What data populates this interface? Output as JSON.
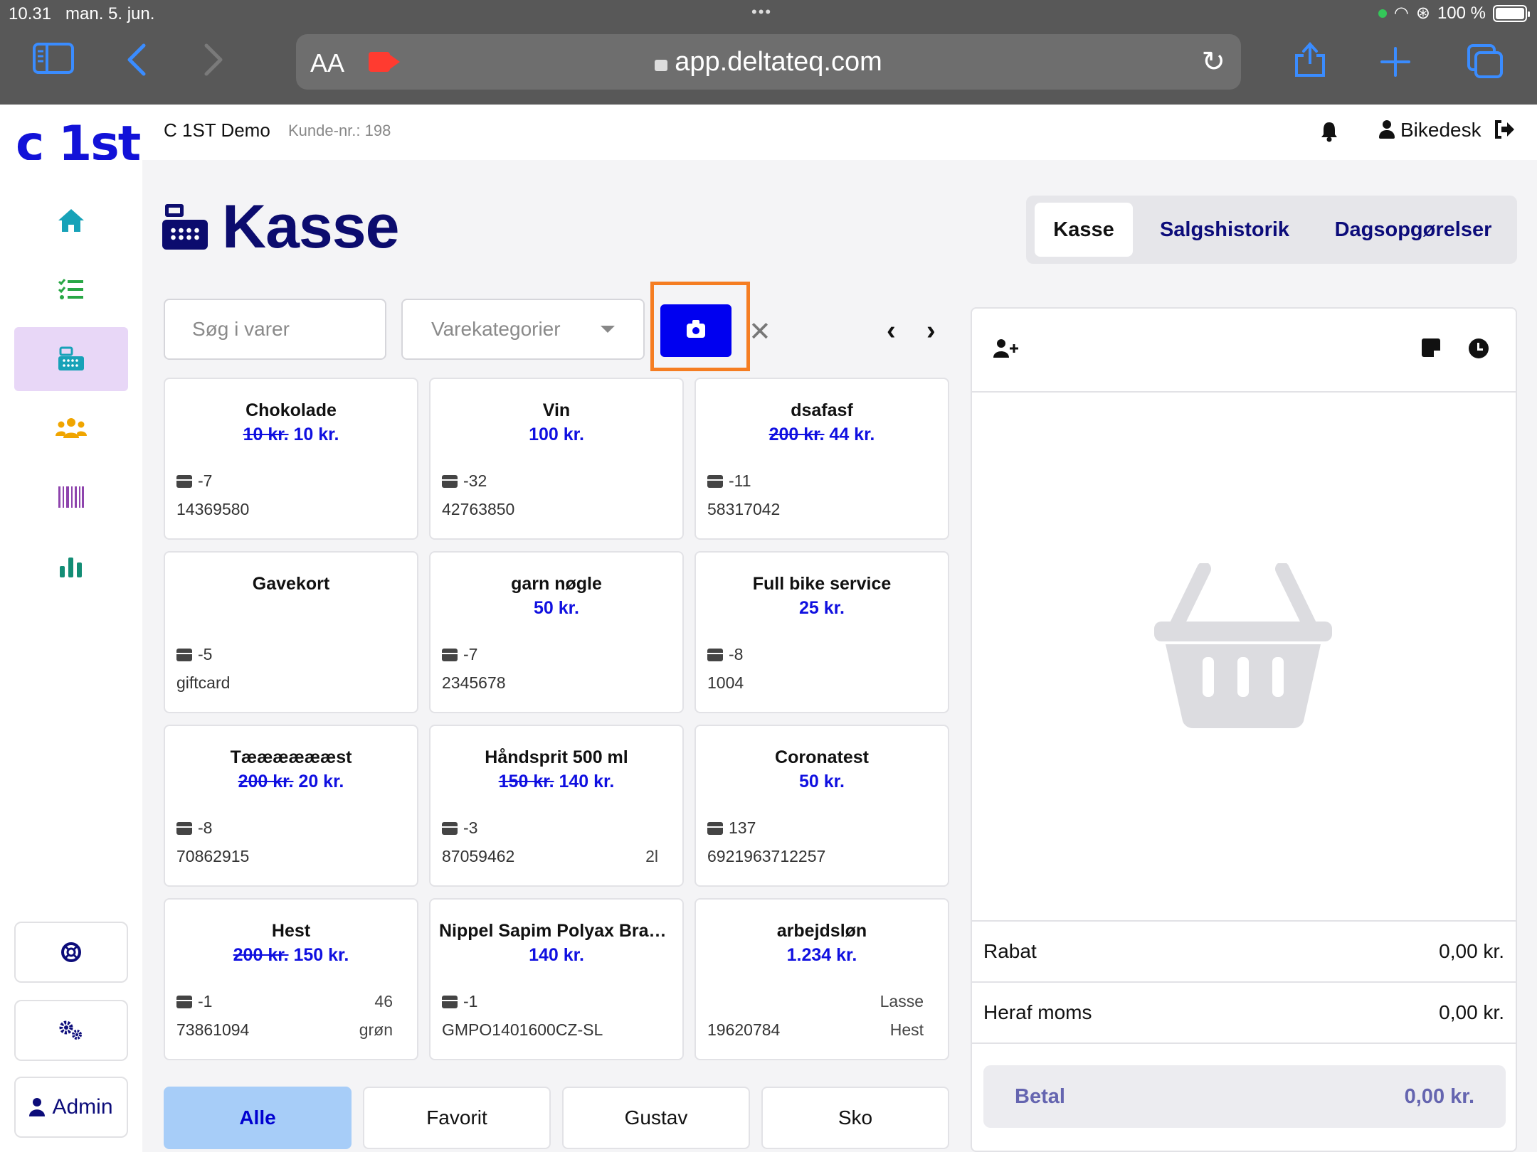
{
  "status_bar": {
    "time": "10.31",
    "date": "man. 5. jun.",
    "battery": "100 %"
  },
  "browser": {
    "text_size": "AA",
    "url": "app.deltateq.com"
  },
  "app": {
    "logo": "c 1st",
    "company": "C 1ST Demo",
    "customer_no": "Kunde-nr.: 198",
    "user": "Bikedesk"
  },
  "sidebar": {
    "items": [
      {
        "icon": "home-icon",
        "color": "#17a2b8"
      },
      {
        "icon": "checklist-icon",
        "color": "#28a745"
      },
      {
        "icon": "cash-register-icon",
        "color": "#17a2b8",
        "active": true
      },
      {
        "icon": "users-icon",
        "color": "#f0a500"
      },
      {
        "icon": "barcode-icon",
        "color": "#8e44ad"
      },
      {
        "icon": "bar-chart-icon",
        "color": "#138d75"
      }
    ],
    "admin_label": "Admin"
  },
  "page": {
    "title": "Kasse"
  },
  "tabs": [
    {
      "label": "Kasse",
      "active": true
    },
    {
      "label": "Salgshistorik"
    },
    {
      "label": "Dagsopgørelser"
    }
  ],
  "search": {
    "placeholder": "Søg i varer",
    "category_placeholder": "Varekategorier"
  },
  "products": [
    {
      "name": "Chokolade",
      "old_price": "10 kr.",
      "price": "10 kr.",
      "stock": "-7",
      "sku": "14369580",
      "extra1": "",
      "extra2": ""
    },
    {
      "name": "Vin",
      "old_price": "",
      "price": "100 kr.",
      "stock": "-32",
      "sku": "42763850",
      "extra1": "",
      "extra2": ""
    },
    {
      "name": "dsafasf",
      "old_price": "200 kr.",
      "price": "44 kr.",
      "stock": "-11",
      "sku": "58317042",
      "extra1": "",
      "extra2": ""
    },
    {
      "name": "Gavekort",
      "old_price": "",
      "price": "",
      "stock": "-5",
      "sku": "giftcard",
      "extra1": "",
      "extra2": ""
    },
    {
      "name": "garn nøgle",
      "old_price": "",
      "price": "50 kr.",
      "stock": "-7",
      "sku": "2345678",
      "extra1": "",
      "extra2": ""
    },
    {
      "name": "Full bike service",
      "old_price": "",
      "price": "25 kr.",
      "stock": "-8",
      "sku": "1004",
      "extra1": "",
      "extra2": ""
    },
    {
      "name": "Tææææææst",
      "old_price": "200 kr.",
      "price": "20 kr.",
      "stock": "-8",
      "sku": "70862915",
      "extra1": "",
      "extra2": ""
    },
    {
      "name": "Håndsprit 500 ml",
      "old_price": "150 kr.",
      "price": "140 kr.",
      "stock": "-3",
      "sku": "87059462",
      "extra1": "",
      "extra2": "2l"
    },
    {
      "name": "Coronatest",
      "old_price": "",
      "price": "50 kr.",
      "stock": "137",
      "sku": "6921963712257",
      "extra1": "",
      "extra2": ""
    },
    {
      "name": "Hest",
      "old_price": "200 kr.",
      "price": "150 kr.",
      "stock": "-1",
      "sku": "73861094",
      "extra1": "46",
      "extra2": "grøn"
    },
    {
      "name": "Nippel Sapim Polyax Brass...",
      "old_price": "",
      "price": "140 kr.",
      "stock": "-1",
      "sku": "GMPO1401600CZ-SL",
      "extra1": "",
      "extra2": ""
    },
    {
      "name": "arbejdsløn",
      "old_price": "",
      "price": "1.234 kr.",
      "stock": "",
      "sku": "19620784",
      "extra1": "Lasse",
      "extra2": "Hest"
    }
  ],
  "categories": [
    {
      "label": "Alle",
      "active": true
    },
    {
      "label": "Favorit"
    },
    {
      "label": "Gustav"
    },
    {
      "label": "Sko"
    }
  ],
  "cart": {
    "rabat_label": "Rabat",
    "rabat_value": "0,00 kr.",
    "moms_label": "Heraf moms",
    "moms_value": "0,00 kr.",
    "pay_label": "Betal",
    "pay_value": "0,00 kr."
  }
}
